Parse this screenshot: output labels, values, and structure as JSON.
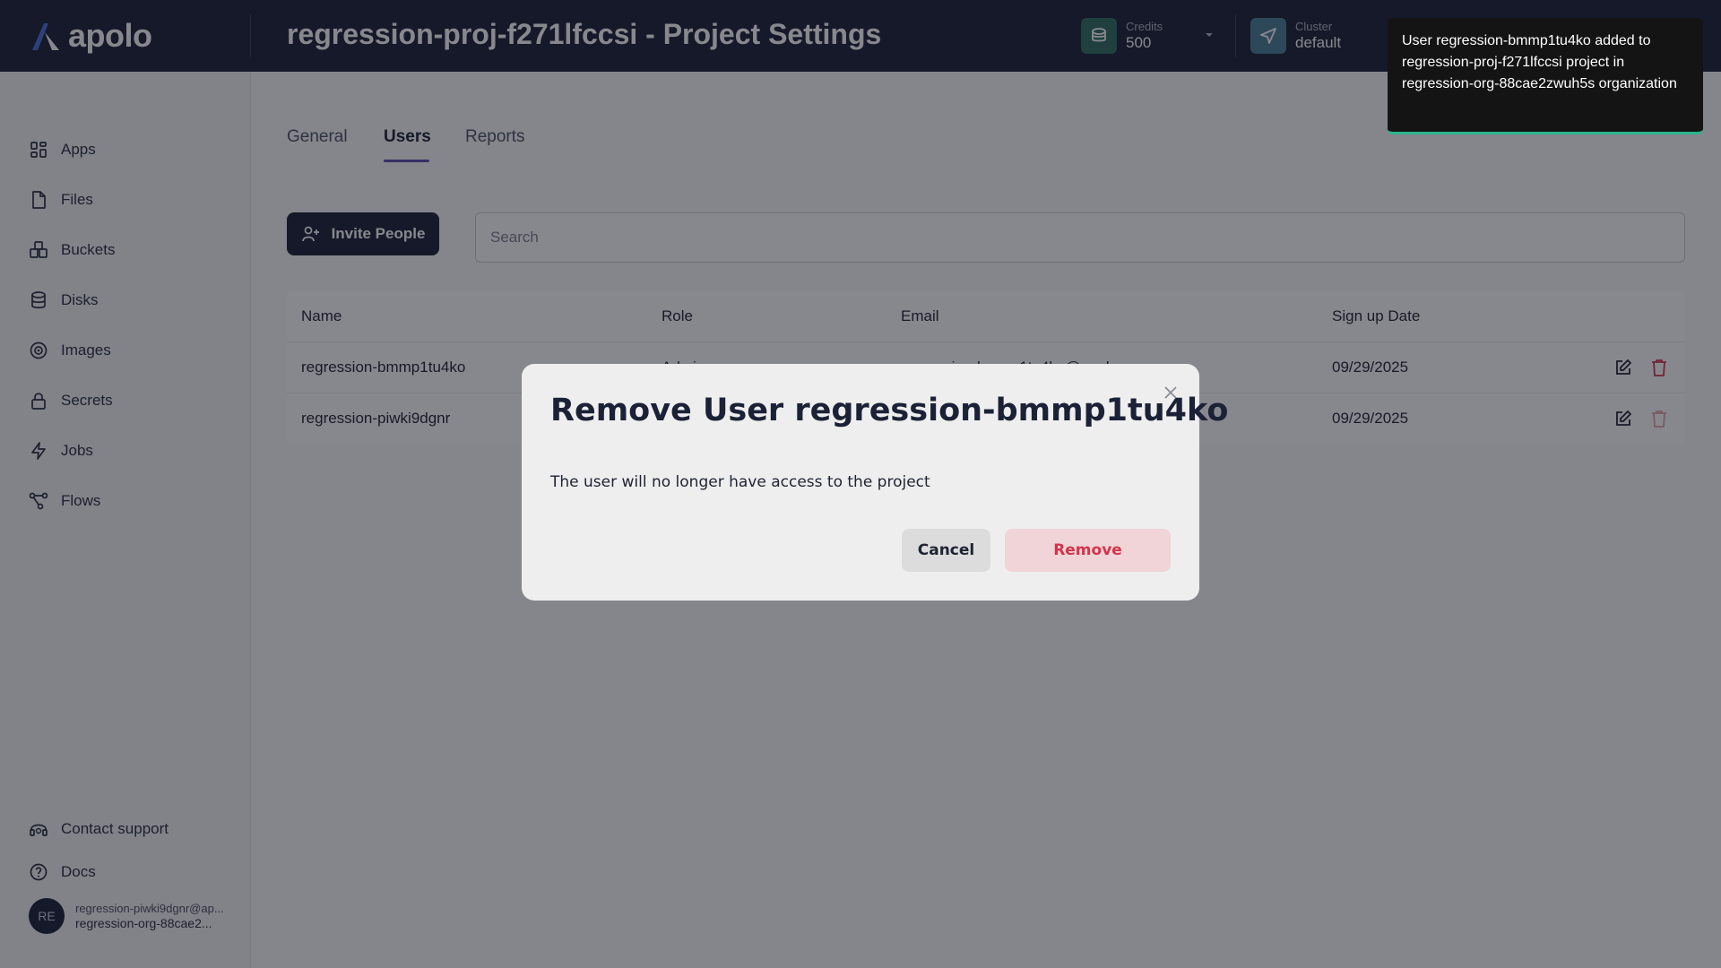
{
  "app": {
    "logo_text": "apolo",
    "page_title": "regression-proj-f271lfccsi - Project Settings"
  },
  "header": {
    "credits": {
      "label": "Credits",
      "value": "500"
    },
    "cluster": {
      "label": "Cluster",
      "value": "default"
    }
  },
  "sidebar": {
    "items": [
      {
        "label": "Apps",
        "icon": "apps-icon"
      },
      {
        "label": "Files",
        "icon": "file-icon"
      },
      {
        "label": "Buckets",
        "icon": "bucket-icon"
      },
      {
        "label": "Disks",
        "icon": "database-icon"
      },
      {
        "label": "Images",
        "icon": "image-icon"
      },
      {
        "label": "Secrets",
        "icon": "lock-icon"
      },
      {
        "label": "Jobs",
        "icon": "lightning-icon"
      },
      {
        "label": "Flows",
        "icon": "flow-icon"
      }
    ],
    "support_label": "Contact support",
    "docs_label": "Docs",
    "user": {
      "initials": "RE",
      "email": "regression-piwki9dgnr@ap...",
      "org": "regression-org-88cae2..."
    }
  },
  "tabs": [
    {
      "label": "General",
      "active": false
    },
    {
      "label": "Users",
      "active": true
    },
    {
      "label": "Reports",
      "active": false
    }
  ],
  "toolbar": {
    "invite_label": "Invite People",
    "search_placeholder": "Search"
  },
  "table": {
    "columns": [
      "Name",
      "Role",
      "Email",
      "Sign up Date"
    ],
    "rows": [
      {
        "name": "regression-bmmp1tu4ko",
        "role": "Admin",
        "email": "regression-bmmp1tu4ko@apolo.us",
        "date": "09/29/2025"
      },
      {
        "name": "regression-piwki9dgnr",
        "role": "",
        "email": "",
        "date": "09/29/2025"
      }
    ]
  },
  "modal": {
    "title": "Remove User regression-bmmp1tu4ko",
    "body": "The user will no longer have access to the project",
    "cancel_label": "Cancel",
    "remove_label": "Remove"
  },
  "toast": {
    "message": "User regression-bmmp1tu4ko added to regression-proj-f271lfccsi project in regression-org-88cae2zwuh5s organization"
  },
  "colors": {
    "header_bg": "#1b2136",
    "accent": "#5a4cb3",
    "danger": "#d2344b",
    "toast_bar": "#2bb68e"
  }
}
